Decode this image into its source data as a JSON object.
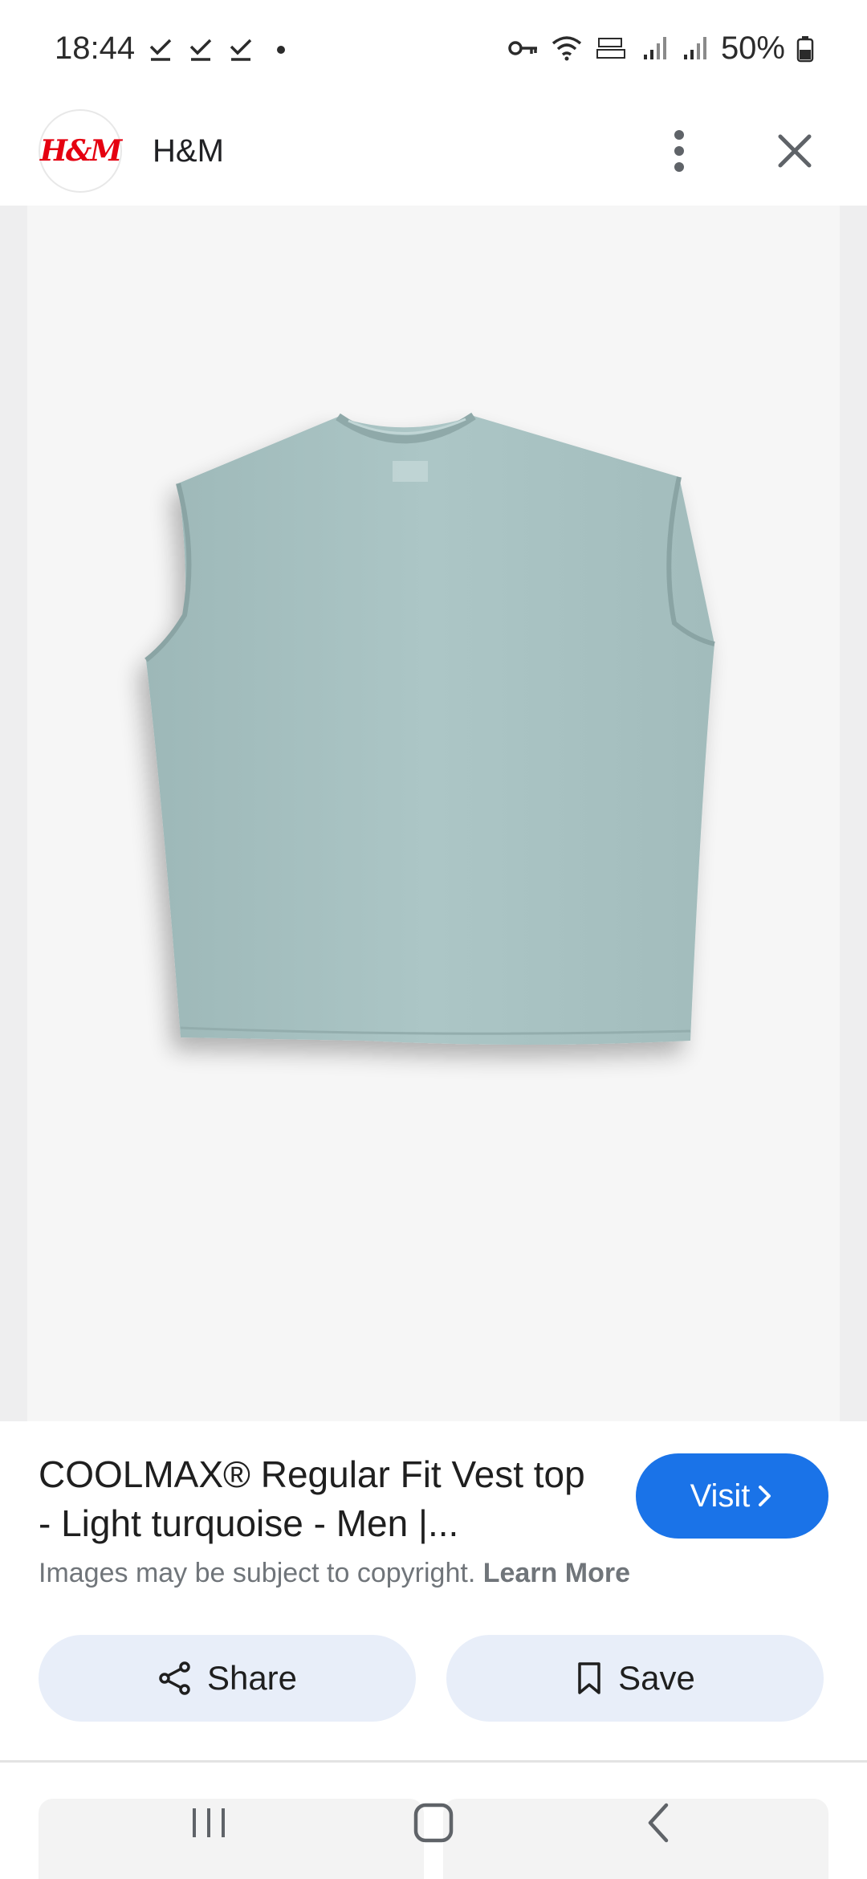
{
  "status_bar": {
    "time": "18:44",
    "battery": "50%",
    "icons": [
      "check-icon",
      "check-icon",
      "check-icon",
      "dot-icon",
      "vpn-key-icon",
      "wifi-icon",
      "volte-icon",
      "signal-icon",
      "signal-icon",
      "battery-icon"
    ]
  },
  "header": {
    "logo_text": "H&M",
    "site_name": "H&M",
    "menu_icon": "more-vert-icon",
    "close_icon": "close-icon"
  },
  "product": {
    "title": "COOLMAX® Regular Fit Vest top - Light turquoise - Men |...",
    "visit_label": "Visit",
    "copyright_text": "Images may be subject to copyright.",
    "learn_more": "Learn More",
    "shirt_color": "#a9c3c3"
  },
  "actions": {
    "share_label": "Share",
    "save_label": "Save"
  },
  "colors": {
    "accent": "#1a73e8",
    "action_button_bg": "#e8eef9",
    "brand_red": "#e50010"
  },
  "nav": {
    "items": [
      "recents-icon",
      "home-icon",
      "back-icon"
    ]
  }
}
